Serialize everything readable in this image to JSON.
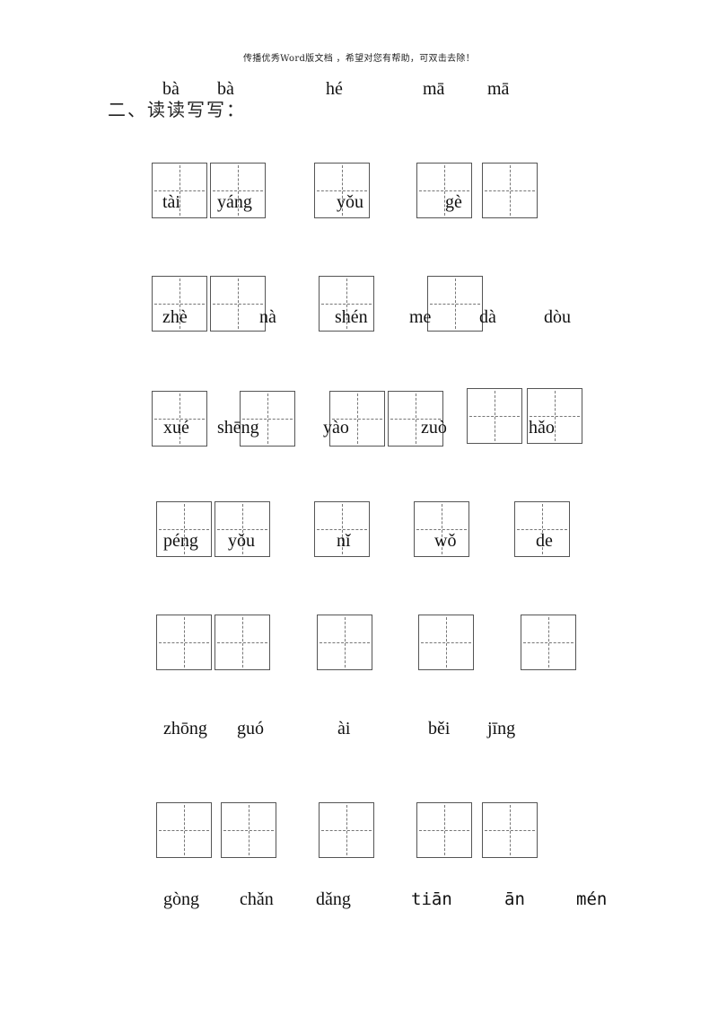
{
  "header_note": "传播优秀Word版文档 ，希望对您有帮助，可双击去除！",
  "section_title": "二、读读写写：",
  "rows": [
    {
      "cells": [
        {
          "pinyin": "bà"
        },
        {
          "pinyin": "bà"
        },
        {
          "pinyin": "hé"
        },
        {
          "pinyin": "mā"
        },
        {
          "pinyin": "mā"
        }
      ]
    },
    {
      "cells": [
        {
          "pinyin": "tài"
        },
        {
          "pinyin": "yáng"
        },
        {
          "pinyin": "yǒu"
        },
        {
          "pinyin": "gè"
        }
      ]
    },
    {
      "cells": [
        {
          "pinyin": "zhè"
        },
        {
          "pinyin": "nà"
        },
        {
          "pinyin": "shén"
        },
        {
          "pinyin": "me"
        },
        {
          "pinyin": "dà"
        },
        {
          "pinyin": "dòu"
        }
      ]
    },
    {
      "cells": [
        {
          "pinyin": "xué"
        },
        {
          "pinyin": "shēng"
        },
        {
          "pinyin": "yào"
        },
        {
          "pinyin": "zuò"
        },
        {
          "pinyin": "hǎo"
        }
      ]
    },
    {
      "cells": [
        {
          "pinyin": "péng"
        },
        {
          "pinyin": "yǒu"
        },
        {
          "pinyin": "nǐ"
        },
        {
          "pinyin": "wǒ"
        },
        {
          "pinyin": "de"
        }
      ]
    },
    {
      "cells": [
        {
          "pinyin": "zhōng"
        },
        {
          "pinyin": "guó"
        },
        {
          "pinyin": "ài"
        },
        {
          "pinyin": "běi"
        },
        {
          "pinyin": "jīng"
        }
      ]
    }
  ],
  "extra_pinyin": [
    "gòng",
    "chǎn",
    "dǎng",
    "tiān",
    "ān",
    "mén"
  ]
}
